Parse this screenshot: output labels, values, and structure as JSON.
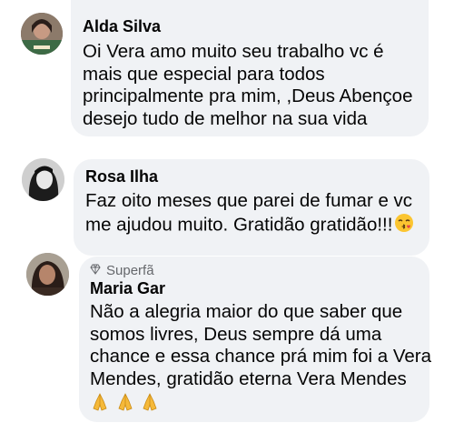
{
  "comments": [
    {
      "author": "Alda Silva",
      "lines": [
        "Oi Vera amo muito seu trabalho vc é",
        "mais que especial para todos",
        "principalmente pra mim,  ,Deus Abençoe",
        "desejo tudo de melhor na sua vida"
      ]
    },
    {
      "author": "Rosa Ilha",
      "lines": [
        "Faz oito meses que parei de fumar e vc",
        "me ajudou muito. Gratidão gratidão!!!"
      ],
      "emoji": "kissing-face-emoji"
    },
    {
      "badge": "Superfã",
      "badge_icon": "diamond-icon",
      "author": "Maria Gar",
      "lines": [
        "Não a  alegria maior do que saber que",
        "somos livres, Deus sempre dá uma",
        "chance e essa chance prá mim foi a Vera",
        "Mendes, gratidão eterna Vera Mendes"
      ],
      "emojis": [
        "folded-hands-emoji",
        "folded-hands-emoji",
        "folded-hands-emoji"
      ]
    }
  ],
  "colors": {
    "bubble": "#f0f2f5",
    "text": "#050505",
    "meta": "#65676b"
  }
}
